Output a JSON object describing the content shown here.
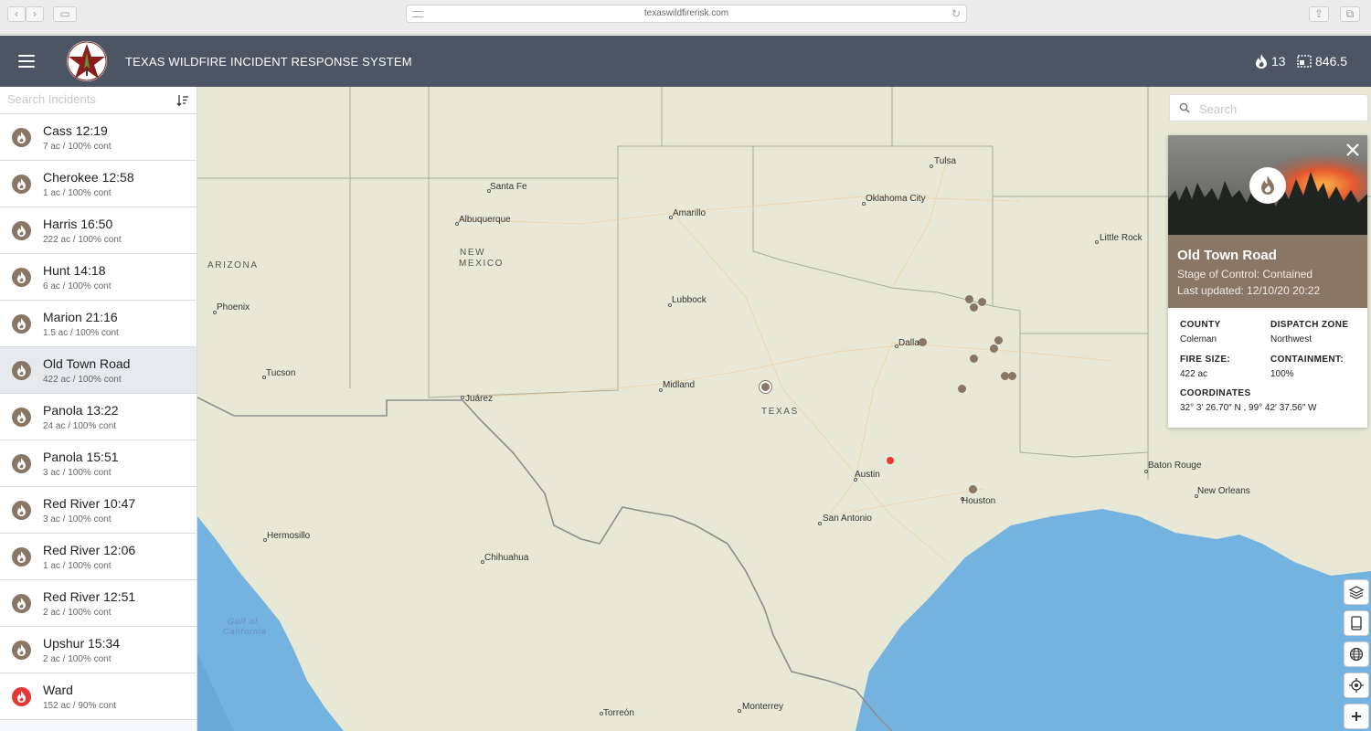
{
  "browser": {
    "url": "texaswildfirerisk.com"
  },
  "header": {
    "title": "TEXAS WILDFIRE INCIDENT RESPONSE SYSTEM",
    "fire_count": "13",
    "acres": "846.5"
  },
  "sidebar": {
    "search_placeholder": "Search Incidents",
    "incidents": [
      {
        "name": "Cass 12:19",
        "meta": "7 ac / 100% cont",
        "status": "contained"
      },
      {
        "name": "Cherokee 12:58",
        "meta": "1 ac / 100% cont",
        "status": "contained"
      },
      {
        "name": "Harris 16:50",
        "meta": "222 ac / 100% cont",
        "status": "contained"
      },
      {
        "name": "Hunt 14:18",
        "meta": "6 ac / 100% cont",
        "status": "contained"
      },
      {
        "name": "Marion 21:16",
        "meta": "1.5 ac / 100% cont",
        "status": "contained"
      },
      {
        "name": "Old Town Road",
        "meta": "422 ac / 100% cont",
        "status": "contained",
        "selected": true
      },
      {
        "name": "Panola 13:22",
        "meta": "24 ac / 100% cont",
        "status": "contained"
      },
      {
        "name": "Panola 15:51",
        "meta": "3 ac / 100% cont",
        "status": "contained"
      },
      {
        "name": "Red River 10:47",
        "meta": "3 ac / 100% cont",
        "status": "contained"
      },
      {
        "name": "Red River 12:06",
        "meta": "1 ac / 100% cont",
        "status": "contained"
      },
      {
        "name": "Red River 12:51",
        "meta": "2 ac / 100% cont",
        "status": "contained"
      },
      {
        "name": "Upshur 15:34",
        "meta": "2 ac / 100% cont",
        "status": "contained"
      },
      {
        "name": "Ward",
        "meta": "152 ac / 90% cont",
        "status": "active"
      }
    ]
  },
  "map": {
    "search_placeholder": "Search",
    "labels": {
      "tulsa": "Tulsa",
      "santa_fe": "Santa Fe",
      "oklahoma_city": "Oklahoma City",
      "albuquerque": "Albuquerque",
      "amarillo": "Amarillo",
      "little_rock": "Little Rock",
      "new_mexico_1": "NEW",
      "new_mexico_2": "MEXICO",
      "arizona": "ARIZONA",
      "phoenix": "Phoenix",
      "lubbock": "Lubbock",
      "dallas": "Dallas",
      "tucson": "Tucson",
      "midland": "Midland",
      "juarez": "Juárez",
      "texas": "TEXAS",
      "austin": "Austin",
      "baton_rouge": "Baton Rouge",
      "houston": "Houston",
      "new_orleans": "New Orleans",
      "san_antonio": "San Antonio",
      "hermosillo": "Hermosillo",
      "chihuahua": "Chihuahua",
      "gulf_1": "Gulf of",
      "gulf_2": "California",
      "torreon": "Torreón",
      "monterrey": "Monterrey"
    }
  },
  "card": {
    "title": "Old Town Road",
    "stage": "Stage of Control: Contained",
    "updated": "Last updated: 12/10/20 20:22",
    "county_label": "COUNTY",
    "county": "Coleman",
    "dispatch_label": "DISPATCH ZONE",
    "dispatch": "Northwest",
    "size_label": "FIRE SIZE:",
    "size": "422 ac",
    "containment_label": "CONTAINMENT:",
    "containment": "100%",
    "coords_label": "COORDINATES",
    "coords": "32° 3′ 26.70″ N , 99° 42′ 37.56″ W"
  },
  "colors": {
    "header_bg": "#4b5563",
    "fire_contained": "#8a7664",
    "fire_active": "#e53935",
    "land": "#e7e8d6",
    "water": "#74b3e0"
  }
}
